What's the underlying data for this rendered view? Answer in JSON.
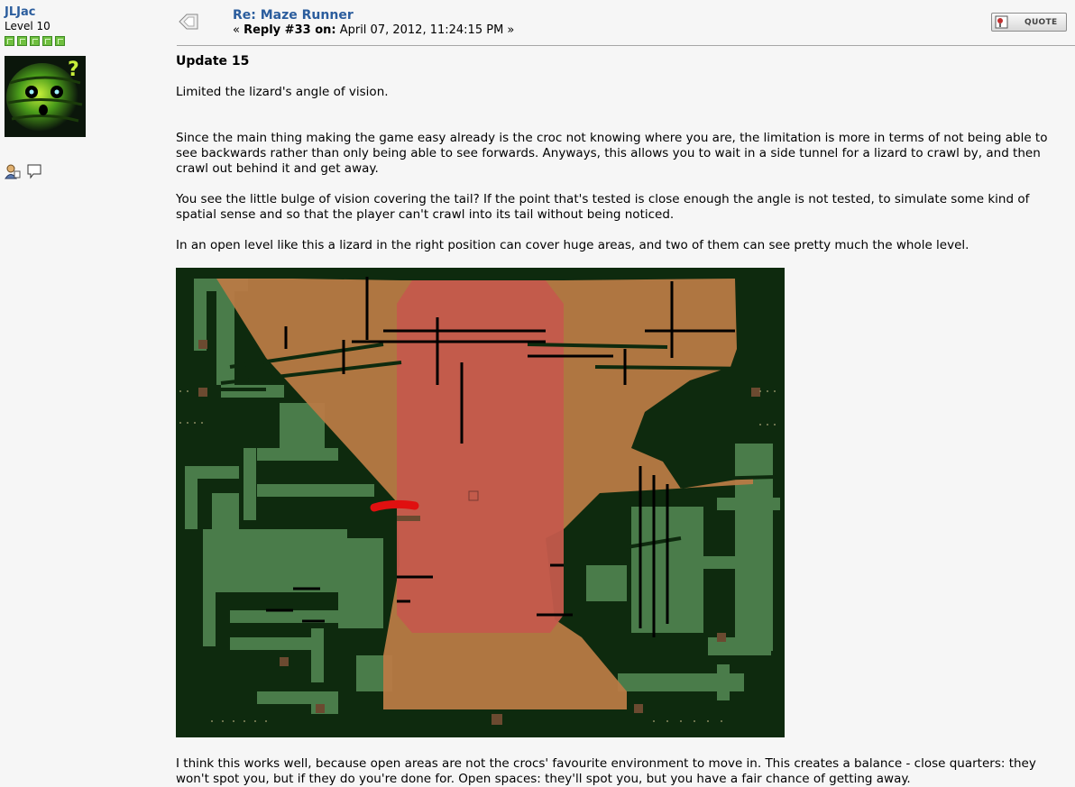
{
  "poster": {
    "name": "JLJac",
    "rank": "Level 10",
    "stars": 5
  },
  "post": {
    "subject": "Re: Maze Runner",
    "reply_prefix": "« ",
    "reply_label": "Reply #33 on:",
    "reply_date": " April 07, 2012, 11:24:15 PM »",
    "quote_label": "QUOTE"
  },
  "content": {
    "title": "Update 15",
    "p1": "Limited the lizard's angle of vision.",
    "p2": "Since the main thing making the game easy already is the croc not knowing where you are, the limitation is more in terms of not being able to see backwards rather than only being able to see forwards. Anyways, this allows you to wait in a side tunnel for a lizard to crawl by, and then crawl out behind it and get away.",
    "p3": "You see the little bulge of vision covering the tail? If the point that's tested is close enough the angle is not tested, to simulate some kind of spatial sense and so that the player can't crawl into its tail without being noticed.",
    "p4": "In an open level like this a lizard in the right position can cover huge areas, and two of them can see pretty much the whole level.",
    "p5": "I think this works well, because open areas are not the crocs' favourite environment to move in. This creates a balance - close quarters: they won't spot you, but if they do you're done for. Open spaces: they'll spot you, but you have a fair chance of getting away."
  },
  "icons": {
    "avatar": "green-creature-avatar",
    "profile": "profile-icon",
    "message": "message-bubble-icon",
    "post": "post-icon",
    "quote": "quote-icon"
  },
  "colors": {
    "link": "#2b5d9d",
    "background": "#f6f6f6",
    "game_wall": "#0e2a0e",
    "game_floor": "#4a7c4a",
    "vision_orange": "#b87a45",
    "vision_red": "#c45a4c",
    "lizard": "#e01010"
  }
}
